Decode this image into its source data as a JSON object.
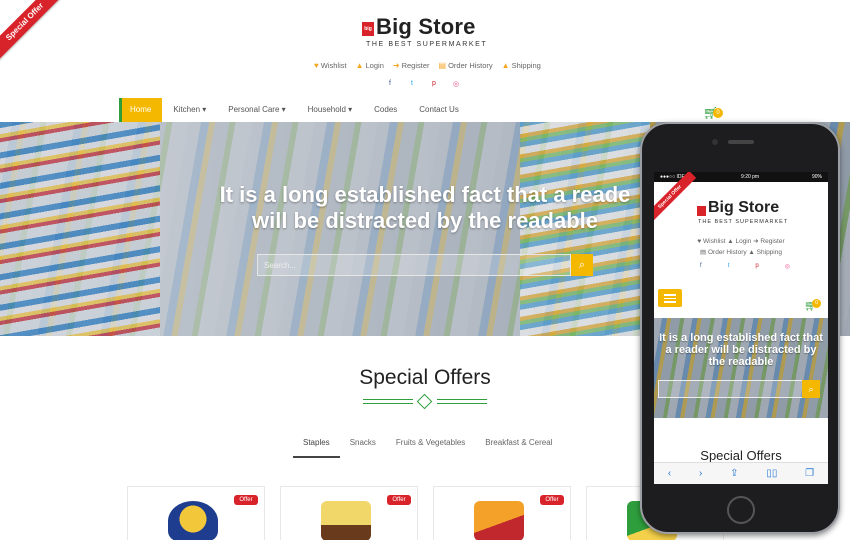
{
  "ribbon": {
    "label": "Special Offer"
  },
  "brand": {
    "mark": "big",
    "name": "Big Store",
    "tagline": "THE BEST SUPERMARKET"
  },
  "toplinks": [
    {
      "label": "Wishlist",
      "icon": "heart-icon"
    },
    {
      "label": "Login",
      "icon": "user-icon"
    },
    {
      "label": "Register",
      "icon": "arrow-right-icon"
    },
    {
      "label": "Order History",
      "icon": "document-icon"
    },
    {
      "label": "Shipping",
      "icon": "truck-icon"
    }
  ],
  "social": [
    {
      "icon": "facebook-icon",
      "glyph": "f",
      "color": "#3b5998"
    },
    {
      "icon": "twitter-icon",
      "glyph": "t",
      "color": "#1da1f2"
    },
    {
      "icon": "pinterest-icon",
      "glyph": "p",
      "color": "#cb2027"
    },
    {
      "icon": "dribbble-icon",
      "glyph": "◎",
      "color": "#ea4c89"
    }
  ],
  "nav": [
    {
      "label": "Home",
      "active": true
    },
    {
      "label": "Kitchen ▾"
    },
    {
      "label": "Personal Care ▾"
    },
    {
      "label": "Household ▾"
    },
    {
      "label": "Codes"
    },
    {
      "label": "Contact Us"
    }
  ],
  "cart": {
    "count": "0"
  },
  "hero": {
    "line1": "It is a long established fact that a reade",
    "line2": "will be distracted by the readable",
    "search_placeholder": "Search..."
  },
  "offers": {
    "title": "Special Offers",
    "tabs": [
      "Staples",
      "Snacks",
      "Fruits & Vegetables",
      "Breakfast & Cereal"
    ],
    "badge": "Offer"
  },
  "mobile": {
    "status_left": "●●●○○ IDEA",
    "status_time": "9:20 pm",
    "status_right": "90%",
    "ribbon": "Special Offer",
    "brand": "Big Store",
    "tagline": "THE BEST SUPERMARKET",
    "links_row1": "♥ Wishlist  ▲ Login  ➜ Register",
    "links_row2": "▤ Order History  ▲ Shipping",
    "hero_title": "It is a long established fact that a reader will be distracted by the readable",
    "offers_title": "Special Offers",
    "cart_count": "0"
  },
  "colors": {
    "accent": "#f5b800",
    "brand_green": "#2e9e3d",
    "ribbon_red": "#d9232a"
  }
}
